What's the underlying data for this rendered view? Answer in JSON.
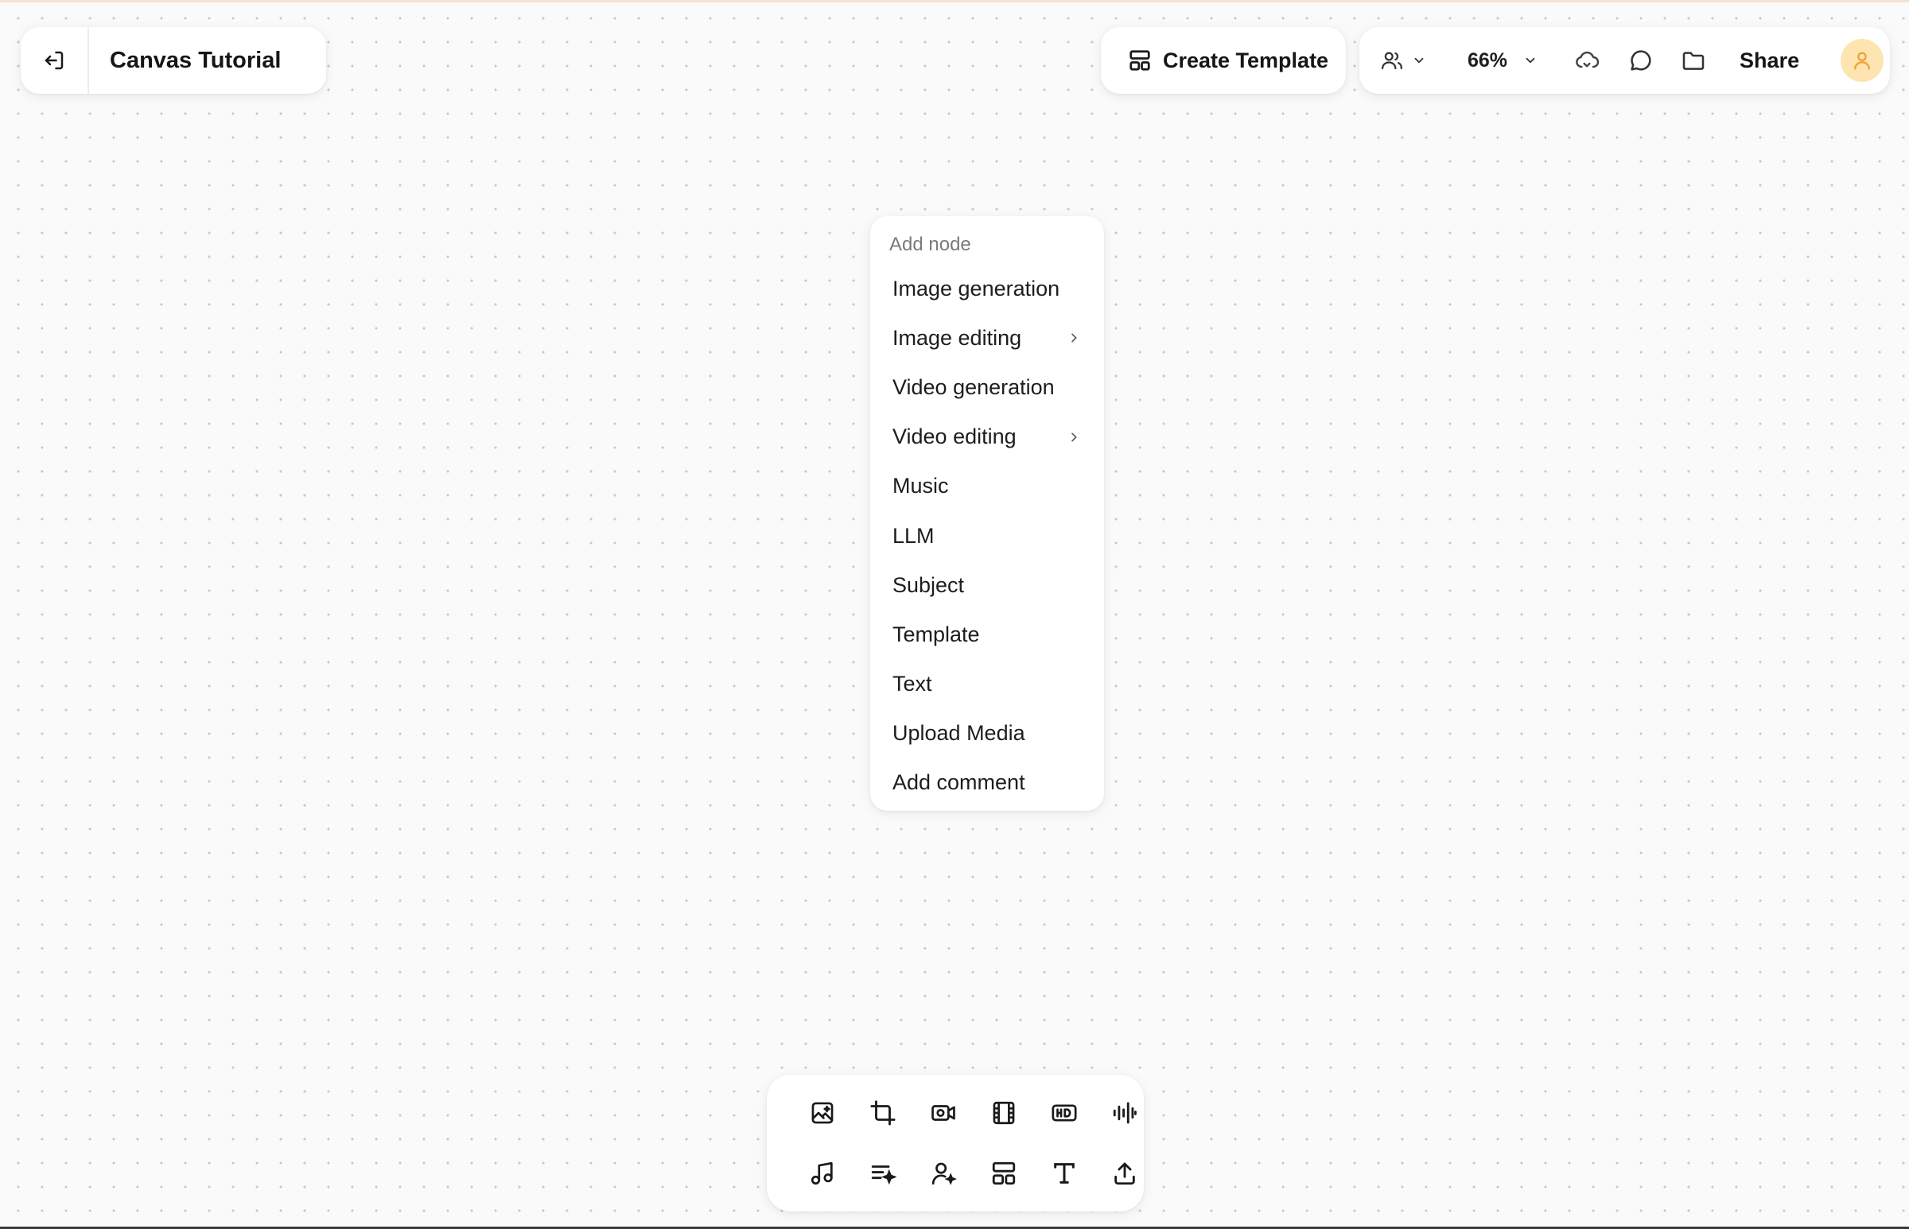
{
  "header": {
    "exit_icon": "exit-icon",
    "title": "Canvas Tutorial"
  },
  "create_template": {
    "icon": "layout-template-icon",
    "label": "Create Template"
  },
  "toolbar": {
    "collaborators_icon": "users-icon",
    "zoom_value": "66%",
    "sync_icon": "cloud-sync-icon",
    "comments_icon": "comment-icon",
    "files_icon": "folder-icon",
    "share_label": "Share",
    "avatar_icon": "user-icon",
    "avatar_color": "#fde4b0"
  },
  "menu": {
    "header": "Add node",
    "items": [
      {
        "label": "Image generation",
        "has_submenu": false
      },
      {
        "label": "Image editing",
        "has_submenu": true
      },
      {
        "label": "Video generation",
        "has_submenu": false
      },
      {
        "label": "Video editing",
        "has_submenu": true
      },
      {
        "label": "Music",
        "has_submenu": false
      },
      {
        "label": "LLM",
        "has_submenu": false
      },
      {
        "label": "Subject",
        "has_submenu": false
      },
      {
        "label": "Template",
        "has_submenu": false
      },
      {
        "label": "Text",
        "has_submenu": false
      },
      {
        "label": "Upload Media",
        "has_submenu": false
      },
      {
        "label": "Add comment",
        "has_submenu": false
      }
    ]
  },
  "bottom_toolbar": {
    "row1": [
      "image-generation-icon",
      "crop-icon",
      "video-camera-icon",
      "film-icon",
      "hd-icon",
      "audio-wave-icon"
    ],
    "row2": [
      "music-note-icon",
      "llm-sparkle-icon",
      "subject-icon",
      "template-icon",
      "text-icon",
      "upload-icon"
    ]
  },
  "colors": {
    "canvas_bg": "#fafafa",
    "accent": "#f0a23c"
  }
}
